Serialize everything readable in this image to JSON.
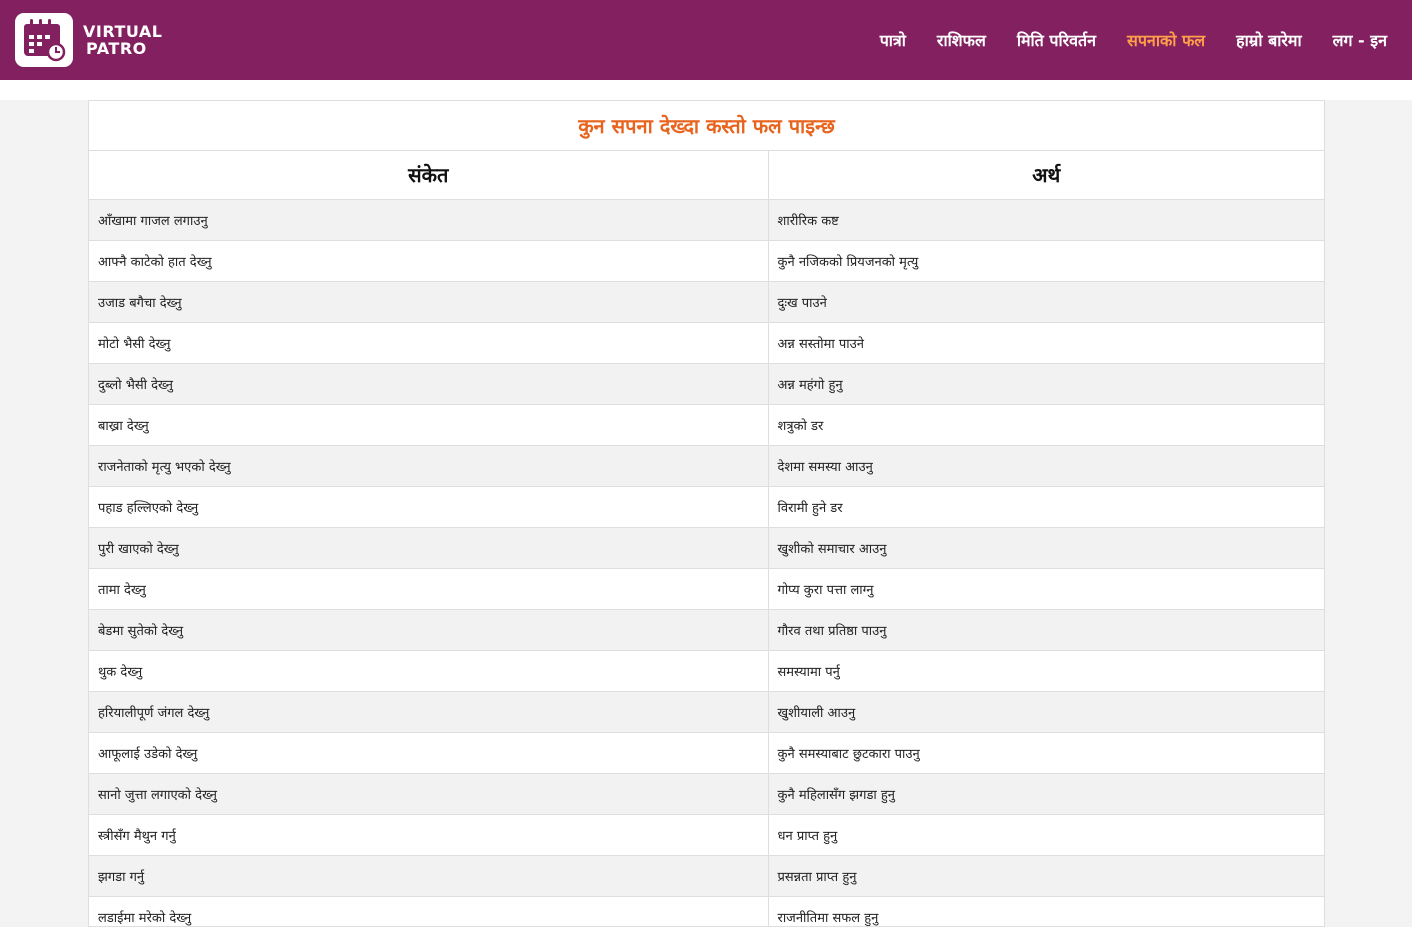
{
  "brand": {
    "line1": "VIRTUAL",
    "line2": "PATRO"
  },
  "nav": [
    {
      "label": "पात्रो"
    },
    {
      "label": "राशिफल"
    },
    {
      "label": "मिति परिवर्तन"
    },
    {
      "label": "सपनाको फल"
    },
    {
      "label": "हाम्रो बारेमा"
    },
    {
      "label": "लग - इन"
    }
  ],
  "table": {
    "title": "कुन सपना देख्दा कस्तो फल पाइन्छ",
    "headers": {
      "sign": "संकेत",
      "meaning": "अर्थ"
    },
    "rows": [
      {
        "sign": "आँखामा गाजल लगाउनु",
        "meaning": "शारीरिक कष्ट"
      },
      {
        "sign": "आफ्नै काटेको हात देख्नु",
        "meaning": "कुनै नजिकको प्रियजनको मृत्यु"
      },
      {
        "sign": "उजाड बगैचा देख्नु",
        "meaning": "दुःख पाउने"
      },
      {
        "sign": "मोटो भैसी देख्नु",
        "meaning": "अन्न सस्तोमा पाउने"
      },
      {
        "sign": "दुब्लो भैसी देख्नु",
        "meaning": "अन्न महंगो हुनु"
      },
      {
        "sign": "बाख्रा देख्नु",
        "meaning": "शत्रुको डर"
      },
      {
        "sign": "राजनेताको मृत्यु भएको देख्नु",
        "meaning": "देशमा समस्या आउनु"
      },
      {
        "sign": "पहाड हल्लिएको देख्नु",
        "meaning": "विरामी हुने डर"
      },
      {
        "sign": "पुरी खाएको देख्नु",
        "meaning": "खुशीको समाचार आउनु"
      },
      {
        "sign": "तामा देख्नु",
        "meaning": "गोप्य कुरा पत्ता लाग्नु"
      },
      {
        "sign": "बेडमा सुतेको देख्नु",
        "meaning": "गौरव तथा प्रतिष्ठा पाउनु"
      },
      {
        "sign": "थुक देख्नु",
        "meaning": "समस्यामा पर्नु"
      },
      {
        "sign": "हरियालीपूर्ण जंगल देख्नु",
        "meaning": "खुशीयाली आउनु"
      },
      {
        "sign": "आफूलाई उडेको देख्नु",
        "meaning": "कुनै समस्याबाट छुटकारा पाउनु"
      },
      {
        "sign": "सानो जुत्ता लगाएको देख्नु",
        "meaning": "कुनै महिलासँग झगडा हुनु"
      },
      {
        "sign": "स्त्रीसँग मैथुन गर्नु",
        "meaning": "धन प्राप्त हुनु"
      },
      {
        "sign": "झगडा गर्नु",
        "meaning": "प्रसन्नता प्राप्त हुनु"
      },
      {
        "sign": "लडाईमा मरेको देख्नु",
        "meaning": "राजनीतिमा सफल हुनु"
      }
    ]
  },
  "colors": {
    "header_bg": "#832160",
    "active_nav": "#ff9e4a",
    "title": "#e8641e"
  }
}
